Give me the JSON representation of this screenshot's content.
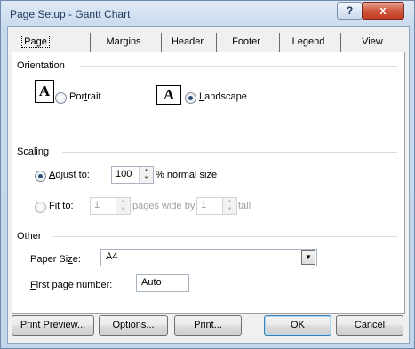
{
  "window": {
    "title": "Page Setup - Gantt Chart",
    "help_label": "?",
    "close_label": "x"
  },
  "tabs": [
    {
      "label": "Page"
    },
    {
      "label": "Margins"
    },
    {
      "label": "Header"
    },
    {
      "label": "Footer"
    },
    {
      "label": "Legend"
    },
    {
      "label": "View"
    }
  ],
  "orientation": {
    "heading": "Orientation",
    "portrait_icon": "A",
    "portrait_pre": "Por",
    "portrait_key": "t",
    "portrait_post": "rait",
    "landscape_icon": "A",
    "landscape_key": "L",
    "landscape_post": "andscape",
    "selected": "landscape"
  },
  "scaling": {
    "heading": "Scaling",
    "adjust_key": "A",
    "adjust_post": "djust to:",
    "adjust_value": "100",
    "adjust_suffix": "% normal size",
    "fit_key": "F",
    "fit_post": "it to:",
    "fit_wide_value": "1",
    "fit_wide_suffix": "pages wide by",
    "fit_tall_value": "1",
    "fit_tall_suffix": "tall",
    "selected": "adjust"
  },
  "other": {
    "heading": "Other",
    "paper_pre": "Paper Si",
    "paper_key": "z",
    "paper_post": "e:",
    "paper_value": "A4",
    "first_key": "F",
    "first_post": "irst page number:",
    "first_value": "Auto"
  },
  "buttons": {
    "preview_pre": "Print Previe",
    "preview_key": "w",
    "preview_post": "...",
    "options_key": "O",
    "options_post": "ptions...",
    "print_key": "P",
    "print_post": "rint...",
    "ok": "OK",
    "cancel": "Cancel"
  }
}
